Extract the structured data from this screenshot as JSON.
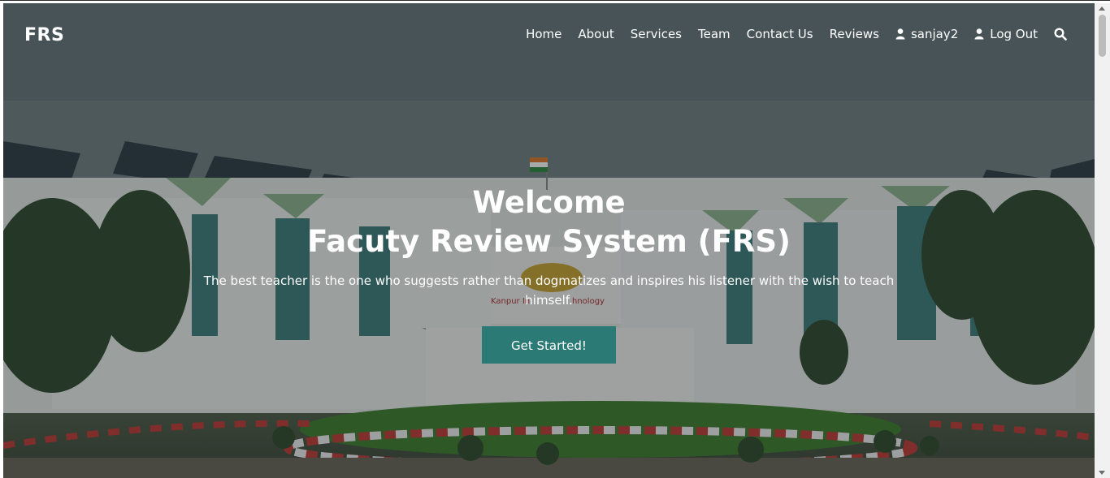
{
  "navbar": {
    "brand": "FRS",
    "links": [
      {
        "label": "Home"
      },
      {
        "label": "About"
      },
      {
        "label": "Services"
      },
      {
        "label": "Team"
      },
      {
        "label": "Contact Us"
      },
      {
        "label": "Reviews"
      }
    ],
    "user": {
      "label": "sanjay2",
      "icon": "user-icon"
    },
    "logout": {
      "label": "Log Out",
      "icon": "user-icon"
    },
    "search": {
      "icon": "search-icon"
    }
  },
  "hero": {
    "title_line1": "Welcome",
    "title_line2": "Facuty Review System (FRS)",
    "tagline": "The best teacher is the one who suggests rather than dogmatizes and inspires his listener with the wish to teach himself.",
    "cta_label": "Get Started!",
    "background_sign_text": "Kanpur Institute of Technology"
  },
  "colors": {
    "cta": "#2b7a75",
    "text": "#ffffff"
  }
}
